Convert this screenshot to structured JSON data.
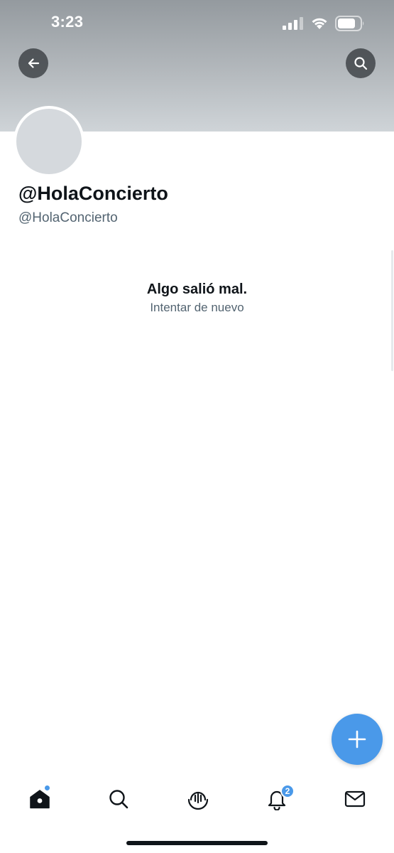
{
  "status_bar": {
    "time": "3:23"
  },
  "profile": {
    "display_name": "@HolaConcierto",
    "handle": "@HolaConcierto"
  },
  "error": {
    "title": "Algo salió mal.",
    "retry_label": "Intentar de nuevo"
  },
  "header": {
    "back_icon": "arrow-left-icon",
    "search_icon": "search-icon"
  },
  "fab": {
    "icon": "plus-icon"
  },
  "tab_bar": {
    "items": [
      {
        "name": "home",
        "icon": "home-icon",
        "has_dot": true
      },
      {
        "name": "search",
        "icon": "search-icon"
      },
      {
        "name": "spaces",
        "icon": "spaces-icon"
      },
      {
        "name": "notifications",
        "icon": "bell-icon",
        "badge": "2"
      },
      {
        "name": "messages",
        "icon": "envelope-icon"
      }
    ]
  },
  "colors": {
    "accent": "#4a99e9",
    "text_primary": "#0f1419",
    "text_secondary": "#536471",
    "avatar_placeholder": "#d5d9dd"
  }
}
